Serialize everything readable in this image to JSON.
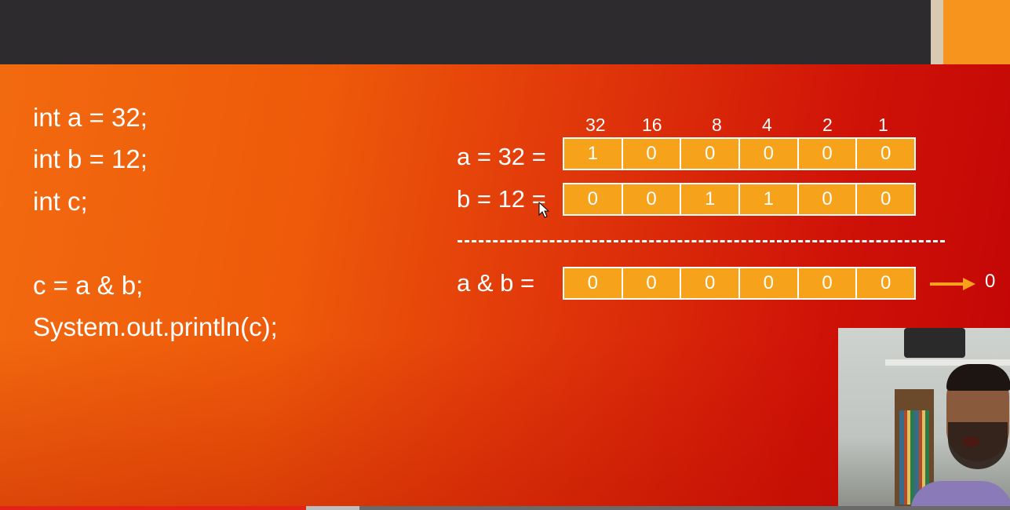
{
  "code_lines": [
    "int a = 32;",
    "int b = 12;",
    "int c;",
    "c = a & b;",
    "System.out.println(c);"
  ],
  "bit_weights": [
    "32",
    "16",
    "8",
    "4",
    "2",
    "1"
  ],
  "rows": {
    "a": {
      "label": "a = 32 =",
      "bits": [
        "1",
        "0",
        "0",
        "0",
        "0",
        "0"
      ]
    },
    "b": {
      "label": "b = 12 =",
      "bits": [
        "0",
        "0",
        "1",
        "1",
        "0",
        "0"
      ]
    },
    "and": {
      "label": "a & b =",
      "bits": [
        "0",
        "0",
        "0",
        "0",
        "0",
        "0"
      ]
    }
  },
  "result_value": "0",
  "colors": {
    "accent": "#f7941d",
    "cell": "#f7a21b",
    "progress": "#e62117"
  },
  "video_progress": 0.303
}
